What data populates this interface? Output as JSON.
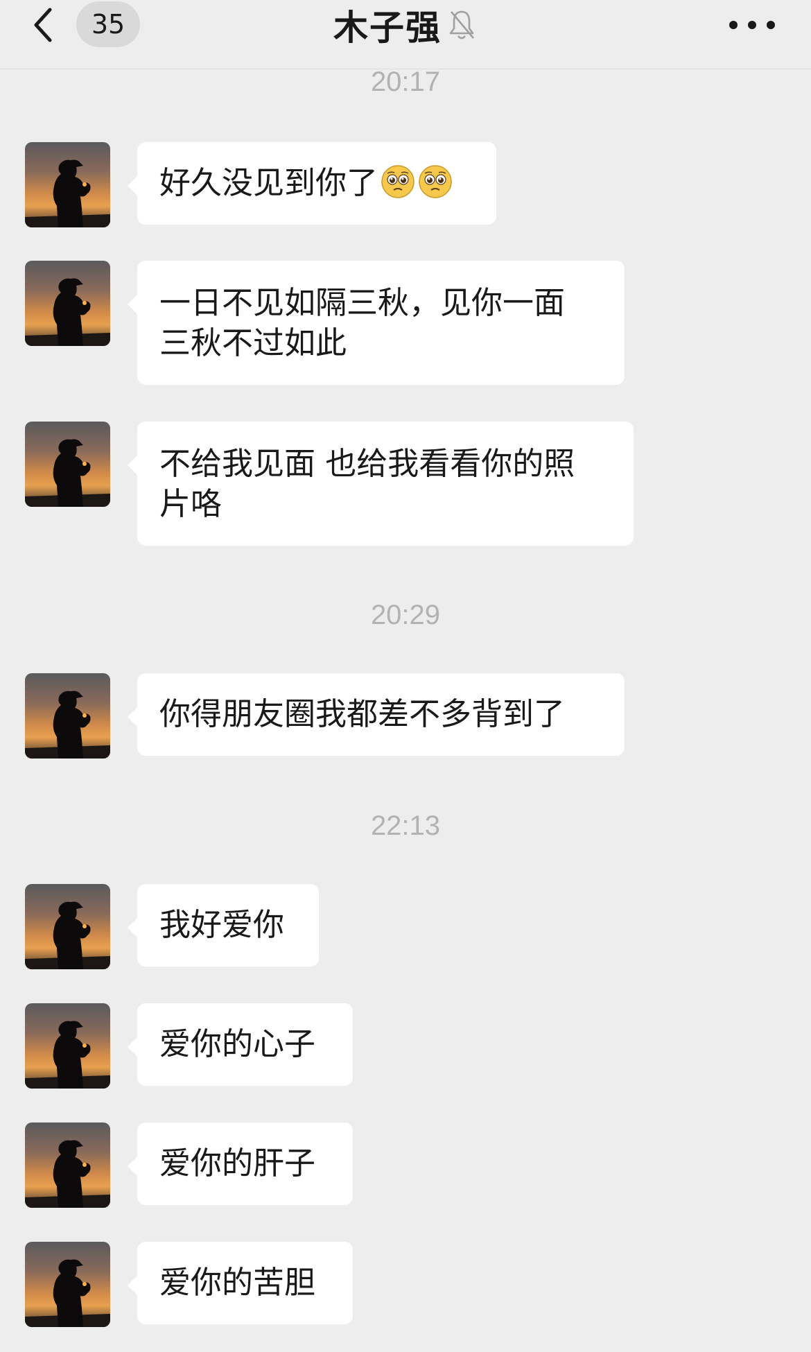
{
  "header": {
    "title": "木子强",
    "unread_count": "35"
  },
  "timestamps": [
    "20:17",
    "20:29",
    "22:13"
  ],
  "messages": [
    {
      "text": "好久没见到你了",
      "emoji_suffix": [
        "pleading-face",
        "pleading-face"
      ]
    },
    {
      "text": "一日不见如隔三秋，见你一面",
      "text2": "三秋不过如此"
    },
    {
      "text": "不给我见面 也给我看看你的照",
      "text2": "片咯"
    },
    {
      "text": "你得朋友圈我都差不多背到了"
    },
    {
      "text": "我好爱你"
    },
    {
      "text": "爱你的心子"
    },
    {
      "text": "爱你的肝子"
    },
    {
      "text": "爱你的苦胆"
    }
  ],
  "colors": {
    "background": "#ededed",
    "bubble": "#ffffff",
    "timestamp": "#b2b2b2",
    "text": "#191919"
  },
  "icons": {
    "back": "back-chevron-icon",
    "mute": "bell-muted-icon",
    "more": "more-dots-icon",
    "avatar": "sunset-silhouette-avatar"
  }
}
